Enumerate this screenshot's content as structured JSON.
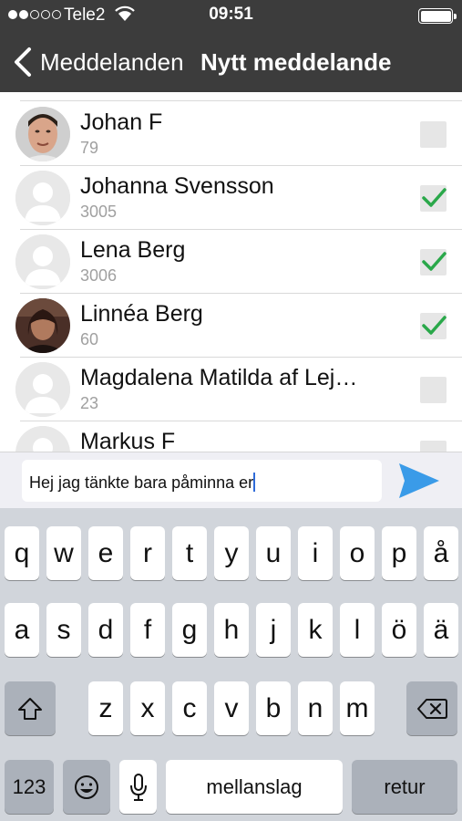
{
  "status": {
    "carrier": "Tele2",
    "time": "09:51",
    "signal_bars": 2,
    "battery": 1.0
  },
  "nav": {
    "back_label": "Meddelanden",
    "title": "Nytt meddelande"
  },
  "contacts": [
    {
      "name": "Johan F",
      "number": "79",
      "checked": false,
      "avatar": "photo-man"
    },
    {
      "name": "Johanna Svensson",
      "number": "3005",
      "checked": true,
      "avatar": "placeholder"
    },
    {
      "name": "Lena Berg",
      "number": "3006",
      "checked": true,
      "avatar": "placeholder"
    },
    {
      "name": "Linnéa Berg",
      "number": "60",
      "checked": true,
      "avatar": "photo-woman"
    },
    {
      "name": "Magdalena Matilda af Lej…",
      "number": "23",
      "checked": false,
      "avatar": "placeholder"
    },
    {
      "name": "Markus F",
      "number": "",
      "checked": false,
      "avatar": "placeholder"
    }
  ],
  "compose": {
    "text": "Hej jag tänkte bara påminna er"
  },
  "keyboard": {
    "row1": [
      "q",
      "w",
      "e",
      "r",
      "t",
      "y",
      "u",
      "i",
      "o",
      "p",
      "å"
    ],
    "row2": [
      "a",
      "s",
      "d",
      "f",
      "g",
      "h",
      "j",
      "k",
      "l",
      "ö",
      "ä"
    ],
    "row3": [
      "z",
      "x",
      "c",
      "v",
      "b",
      "n",
      "m"
    ],
    "numbers": "123",
    "space": "mellanslag",
    "return": "retur"
  },
  "colors": {
    "nav_bg": "#3c3c3c",
    "check_green": "#2aa84a",
    "send_blue": "#3a9be8"
  }
}
